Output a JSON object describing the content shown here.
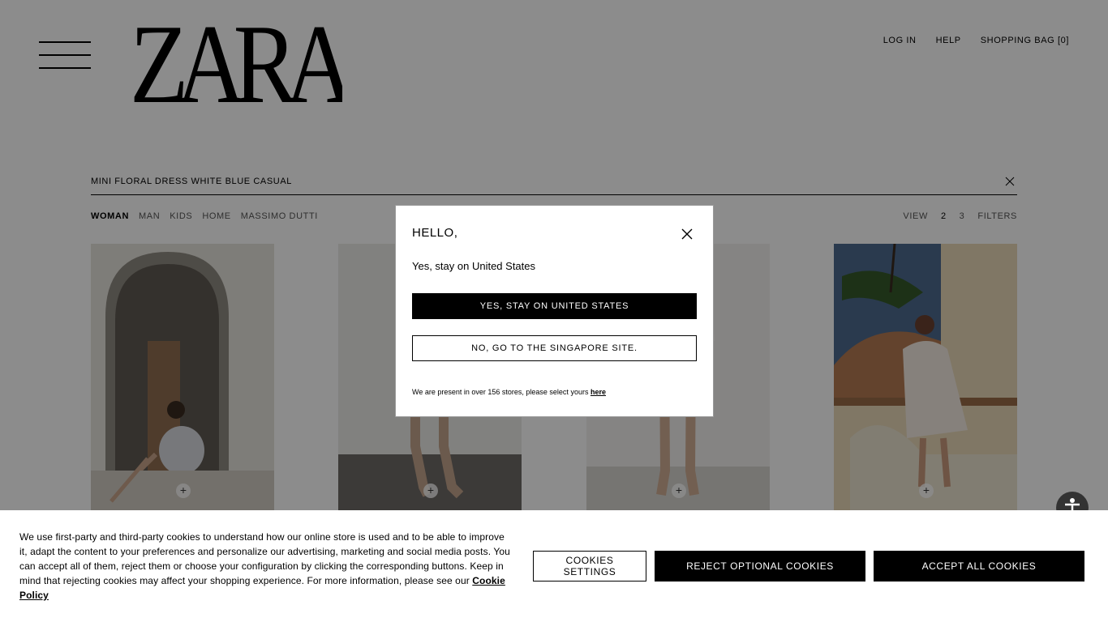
{
  "header": {
    "logo_text": "ZARA",
    "menu_icon": "hamburger-menu-icon",
    "links": [
      {
        "label": "LOG IN"
      },
      {
        "label": "HELP"
      },
      {
        "label": "SHOPPING BAG [0]"
      }
    ]
  },
  "search": {
    "query": "MINI FLORAL DRESS WHITE BLUE CASUAL",
    "clear_icon": "close-icon"
  },
  "categories": {
    "tabs": [
      "WOMAN",
      "MAN",
      "KIDS",
      "HOME",
      "MASSIMO DUTTI"
    ],
    "active": "WOMAN"
  },
  "view": {
    "label": "VIEW",
    "options": [
      "2",
      "3"
    ],
    "filters_label": "FILTERS"
  },
  "products": [
    {
      "add_icon": "plus-icon"
    },
    {
      "add_icon": "plus-icon"
    },
    {
      "add_icon": "plus-icon"
    },
    {
      "add_icon": "plus-icon"
    }
  ],
  "modal": {
    "title": "HELLO,",
    "subtitle": "Yes, stay on United States",
    "primary_button": "YES, STAY ON UNITED STATES",
    "secondary_button": "NO, GO TO THE SINGAPORE SITE.",
    "footer_text": "We are present in over 156 stores, please select yours ",
    "footer_link": "here",
    "close_icon": "close-icon"
  },
  "accessibility": {
    "icon": "accessibility-icon"
  },
  "cookies": {
    "text": "We use first-party and third-party cookies to understand how our online store is used and to be able to improve it, adapt the content to your preferences and personalize our advertising, marketing and social media posts. You can accept all of them, reject them or choose your configuration by clicking the corresponding buttons. Keep in mind that rejecting cookies may affect your shopping experience. For more information, please see our ",
    "policy_link": "Cookie Policy",
    "settings_button": "COOKIES SETTINGS",
    "reject_button": "REJECT OPTIONAL COOKIES",
    "accept_button": "ACCEPT ALL COOKIES"
  },
  "colors": {
    "overlay": "rgba(0,0,0,0.45)",
    "primary": "#000000",
    "background": "#ffffff"
  }
}
